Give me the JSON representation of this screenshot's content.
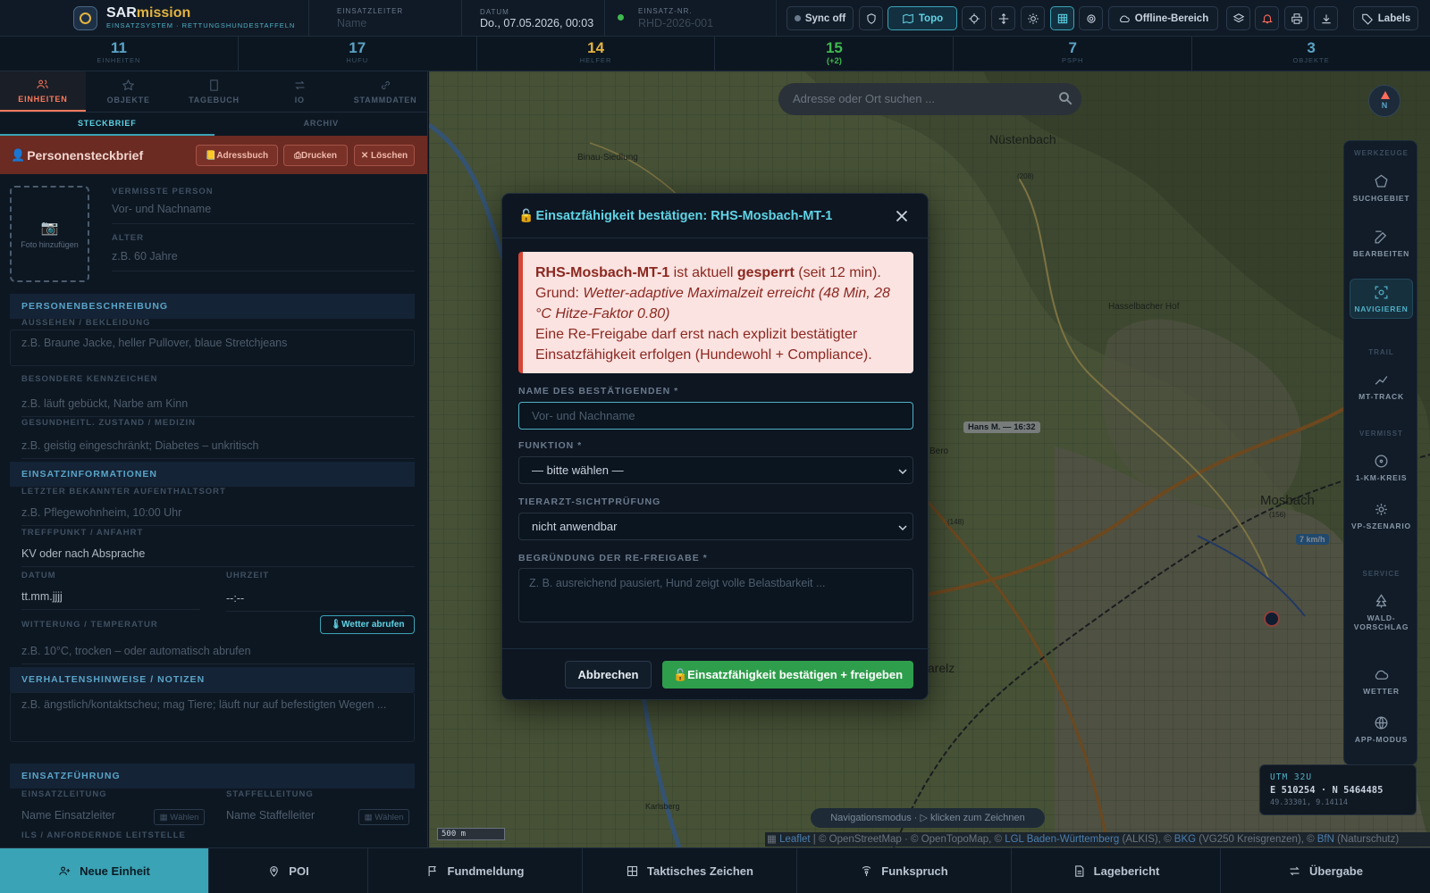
{
  "header": {
    "logo_sar": "SAR",
    "logo_mission": "mission",
    "logo_subtitle": "EINSATZSYSTEM · RETTUNGSHUNDESTAFFELN",
    "einsatzleiter_label": "EINSATZLEITER",
    "einsatzleiter_placeholder": "Name",
    "datum_label": "DATUM",
    "datum_value": "Do., 07.05.2026, 00:03",
    "einsatznr_label": "EINSATZ-NR.",
    "einsatznr_placeholder": "RHD-2026-001",
    "sync_label": "Sync off",
    "topo_label": "Topo",
    "offline_label": "Offline-Bereich",
    "labels_label": "Labels"
  },
  "stats": [
    {
      "value": "11",
      "label": "EINHEITEN"
    },
    {
      "value": "17",
      "label": "HUFU"
    },
    {
      "value": "14",
      "label": "HELFER"
    },
    {
      "value": "15",
      "label": "",
      "sub": "(+2)"
    },
    {
      "value": "7",
      "label": "PSPH"
    },
    {
      "value": "3",
      "label": "OBJEKTE"
    }
  ],
  "left": {
    "tabs": [
      "EINHEITEN",
      "OBJEKTE",
      "TAGEBUCH",
      "IO",
      "STAMMDATEN"
    ],
    "subtabs": [
      "STECKBRIEF",
      "ARCHIV"
    ],
    "profile_title": "Personensteckbrief",
    "btn_adressbuch": "Adressbuch",
    "btn_drucken": "Drucken",
    "btn_loeschen": "Löschen",
    "photo_label": "Foto hinzufügen",
    "vermisste_label": "VERMISSTE PERSON",
    "vermisste_placeholder": "Vor- und Nachname",
    "alter_label": "ALTER",
    "alter_placeholder": "z.B. 60 Jahre",
    "sec_personenbeschreibung": "PERSONENBESCHREIBUNG",
    "aussehen_label": "AUSSEHEN / BEKLEIDUNG",
    "aussehen_placeholder": "z.B. Braune Jacke, heller Pullover, blaue Stretchjeans",
    "kennzeichen_label": "BESONDERE KENNZEICHEN",
    "kennzeichen_placeholder": "z.B. läuft gebückt, Narbe am Kinn",
    "gesundheit_label": "GESUNDHEITL. ZUSTAND / MEDIZIN",
    "gesundheit_placeholder": "z.B. geistig eingeschränkt; Diabetes – unkritisch",
    "sec_einsatzinfo": "EINSATZINFORMATIONEN",
    "aufenthalt_label": "LETZTER BEKANNTER AUFENTHALTSORT",
    "aufenthalt_placeholder": "z.B. Pflegewohnheim, 10:00 Uhr",
    "treffpunkt_label": "TREFFPUNKT / ANFAHRT",
    "treffpunkt_value": "KV oder nach Absprache",
    "datum_label": "DATUM",
    "datum_placeholder": "tt.mm.jjjj",
    "uhrzeit_label": "UHRZEIT",
    "uhrzeit_placeholder": "--:--",
    "witterung_label": "WITTERUNG / TEMPERATUR",
    "wetter_button": "Wetter abrufen",
    "witterung_placeholder": "z.B. 10°C, trocken – oder automatisch abrufen",
    "sec_verhalten": "VERHALTENSHINWEISE / NOTIZEN",
    "verhalten_placeholder": "z.B. ängstlich/kontaktscheu; mag Tiere; läuft nur auf befestigten Wegen ...",
    "sec_einsatzfuehrung": "EINSATZFÜHRUNG",
    "einsatzleitung_label": "EINSATZLEITUNG",
    "einsatzleitung_placeholder": "Name Einsatzleiter",
    "staffelleitung_label": "STAFFELLEITUNG",
    "staffelleitung_placeholder": "Name Staffelleiter",
    "waehlen": "Wählen",
    "ils_label": "ILS / ANFORDERNDE LEITSTELLE"
  },
  "map": {
    "search_placeholder": "Adresse oder Ort suchen ...",
    "compass_label": "N",
    "places": [
      "Nüstenbach",
      "Mosbach",
      "Binau-Siedlung",
      "Hans M. — 16:32",
      "Bero",
      "Neckarelz",
      "Karlsberg",
      "Hasselbacher Hof",
      "7 km/h"
    ],
    "place_numbers": [
      "(208)",
      "(148)",
      "(156)"
    ],
    "scale": "500 m",
    "nav_hint": "Navigationsmodus · ▷ klicken zum Zeichnen",
    "attribution": {
      "leaflet": "Leaflet",
      "text1": " | © OpenStreetMap · © OpenTopoMap, © ",
      "lgl": "LGL Baden-Württemberg",
      "text2": " (ALKIS), © ",
      "bkg": "BKG",
      "text3": " (VG250 Kreisgrenzen), © ",
      "bfn": "BfN",
      "text4": " (Naturschutz)"
    },
    "utm": {
      "zone": "UTM 32U",
      "coords": "E 510254 · N 5464485",
      "latlon": "49.33301, 9.14114"
    }
  },
  "tools": {
    "grp_werkzeuge": "WERKZEUGE",
    "suchgebiet": "SUCHGEBIET",
    "bearbeiten": "BEARBEITEN",
    "navigieren": "NAVIGIEREN",
    "grp_trail": "TRAIL",
    "mttrack": "MT-TRACK",
    "grp_vermisst": "VERMISST",
    "kreis": "1-KM-KREIS",
    "vp": "VP-SZENARIO",
    "grp_service": "SERVICE",
    "wald": "WALD-VORSCHLAG",
    "wetter": "WETTER",
    "app": "APP-MODUS"
  },
  "modal": {
    "title": "Einsatzfähigkeit bestätigen: RHS-Mosbach-MT-1",
    "alert_unit": "RHS-Mosbach-MT-1",
    "alert_is": " ist aktuell ",
    "alert_status": "gesperrt",
    "alert_since": " (seit 12 min).",
    "alert_reason_label": "Grund: ",
    "alert_reason": "Wetter-adaptive Maximalzeit erreicht (48 Min, 28 °C Hitze-Faktor 0.80)",
    "alert_text": "Eine Re-Freigabe darf erst nach explizit bestätigter Einsatzfähigkeit erfolgen (Hundewohl + Compliance).",
    "name_label": "NAME DES BESTÄTIGENDEN *",
    "name_placeholder": "Vor- und Nachname",
    "funktion_label": "FUNKTION *",
    "funktion_value": "— bitte wählen —",
    "tierarzt_label": "TIERARZT-SICHTPRÜFUNG",
    "tierarzt_value": "nicht anwendbar",
    "begruendung_label": "BEGRÜNDUNG DER RE-FREIGABE *",
    "begruendung_placeholder": "Z. B. ausreichend pausiert, Hund zeigt volle Belastbarkeit ...",
    "cancel": "Abbrechen",
    "confirm": "Einsatzfähigkeit bestätigen + freigeben"
  },
  "bottom": [
    "Neue Einheit",
    "POI",
    "Fundmeldung",
    "Taktisches Zeichen",
    "Funkspruch",
    "Lagebericht",
    "Übergabe"
  ],
  "colors": {
    "accent": "#3aa3b5",
    "danger": "#6b2a22",
    "success": "#2f9e4c",
    "alert_bg": "#fbe3e1"
  }
}
